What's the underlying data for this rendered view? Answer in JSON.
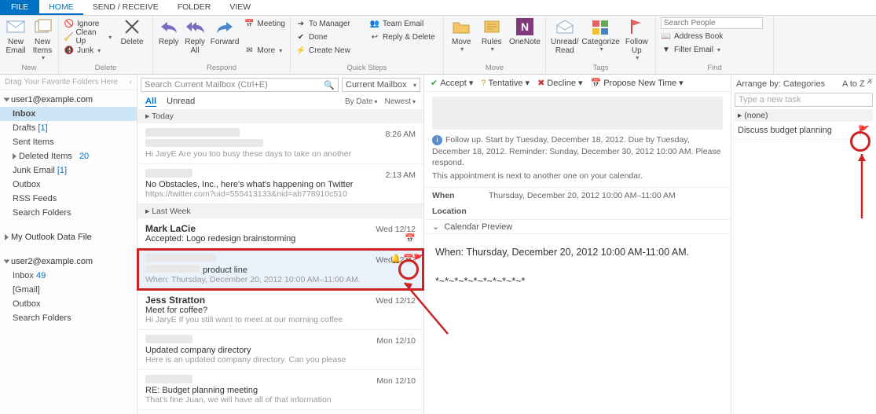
{
  "tabs": {
    "file": "FILE",
    "home": "HOME",
    "sendrecv": "SEND / RECEIVE",
    "folder": "FOLDER",
    "view": "VIEW"
  },
  "ribbon": {
    "new": {
      "email": "New Email",
      "items": "New Items",
      "label": "New"
    },
    "delete": {
      "ignore": "Ignore",
      "cleanup": "Clean Up",
      "junk": "Junk",
      "delete": "Delete",
      "label": "Delete"
    },
    "respond": {
      "reply": "Reply",
      "replyall": "Reply All",
      "forward": "Forward",
      "meeting": "Meeting",
      "more": "More",
      "label": "Respond"
    },
    "quick": {
      "tomgr": "To Manager",
      "done": "Done",
      "create": "Create New",
      "team": "Team Email",
      "replydel": "Reply & Delete",
      "label": "Quick Steps"
    },
    "move": {
      "move": "Move",
      "rules": "Rules",
      "onenote": "OneNote",
      "label": "Move"
    },
    "tags": {
      "unread": "Unread/ Read",
      "cat": "Categorize",
      "follow": "Follow Up",
      "label": "Tags"
    },
    "find": {
      "search_ph": "Search People",
      "addr": "Address Book",
      "filter": "Filter Email",
      "label": "Find"
    }
  },
  "nav": {
    "hint": "Drag Your Favorite Folders Here",
    "acct1": "user1@example.com",
    "inbox": "Inbox",
    "drafts": "Drafts",
    "drafts_n": "[1]",
    "sent": "Sent Items",
    "deleted": "Deleted Items",
    "deleted_n": "20",
    "junk": "Junk Email",
    "junk_n": "[1]",
    "outbox": "Outbox",
    "rss": "RSS Feeds",
    "search": "Search Folders",
    "datafile": "My Outlook Data File",
    "acct2": "user2@example.com",
    "inbox2": "Inbox",
    "inbox2_n": "49",
    "gmail": "[Gmail]",
    "outbox2": "Outbox",
    "search2": "Search Folders"
  },
  "list": {
    "search_ph": "Search Current Mailbox (Ctrl+E)",
    "scope": "Current Mailbox",
    "filter_all": "All",
    "filter_unread": "Unread",
    "bydate": "By Date",
    "newest": "Newest",
    "today": "Today",
    "lastweek": "Last Week",
    "msgs": [
      {
        "from": "",
        "subj": "",
        "prev": "Hi JaryE  Are you too busy these days to take on another",
        "date": "8:26 AM"
      },
      {
        "from": "",
        "subj": "No Obstacles, Inc., here's what's happening on Twitter",
        "prev": "https://twitter.com?uid=555413133&nid=ab778910c510",
        "date": "2:13 AM"
      },
      {
        "from": "Mark LaCie",
        "subj": "Accepted: Logo redesign brainstorming",
        "prev": "",
        "date": "Wed 12/12"
      },
      {
        "from": "",
        "subj": "product line",
        "prev": "When: Thursday, December 20, 2012 10:00 AM–11:00 AM.",
        "date": "Wed 12/12"
      },
      {
        "from": "Jess Stratton",
        "subj": "Meet for coffee?",
        "prev": "Hi JaryE  If you still want to meet at our morning coffee",
        "date": "Wed 12/12"
      },
      {
        "from": "",
        "subj": "Updated company directory",
        "prev": "Here is an updated company directory. Can you please",
        "date": "Mon 12/10"
      },
      {
        "from": "",
        "subj": "RE: Budget planning meeting",
        "prev": "That's fine Juan, we will have all of that information",
        "date": "Mon 12/10"
      }
    ]
  },
  "read": {
    "accept": "Accept",
    "tentative": "Tentative",
    "decline": "Decline",
    "propose": "Propose New Time",
    "followup": "Follow up.  Start by Tuesday, December 18, 2012.  Due by Tuesday, December 18, 2012.  Reminder: Sunday, December 30, 2012 10:00 AM. Please respond.",
    "adjacent": "This appointment is next to another one on your calendar.",
    "when_lab": "When",
    "when_val": "Thursday, December 20, 2012 10:00 AM–11:00 AM",
    "loc_lab": "Location",
    "calprev": "Calendar Preview",
    "body_when": "When: Thursday, December 20, 2012 10:00 AM-11:00 AM.",
    "sep": "*~*~*~*~*~*~*~*~*~*"
  },
  "tasks": {
    "arrange": "Arrange by: Categories",
    "atoz": "A to Z",
    "newtask_ph": "Type a new task",
    "group_none": "(none)",
    "task1": "Discuss budget planning"
  }
}
